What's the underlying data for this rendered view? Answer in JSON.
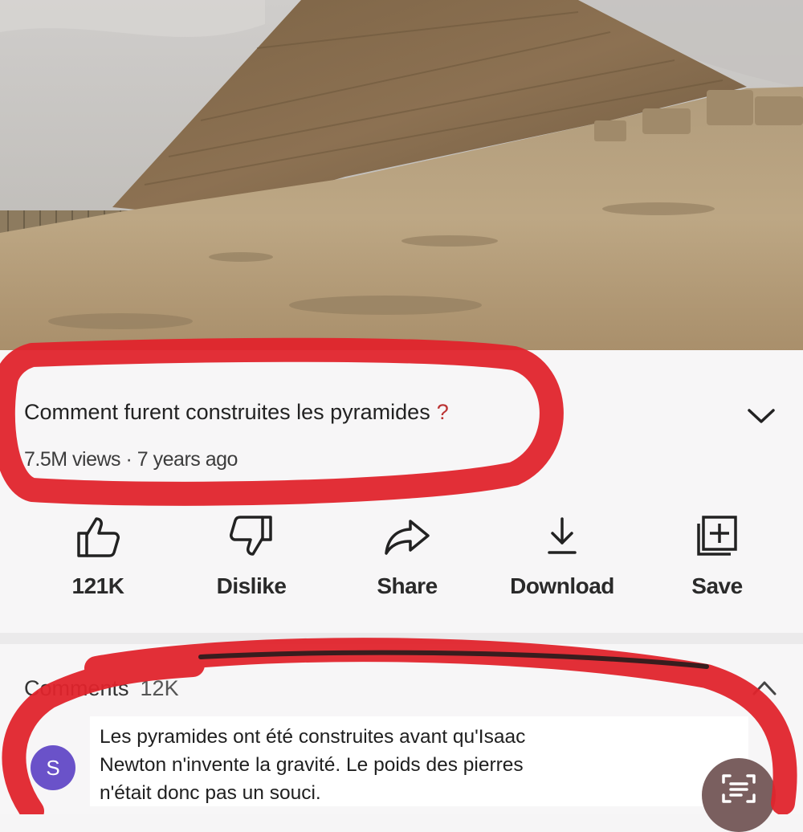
{
  "video": {
    "title": "Comment furent construites les pyramides",
    "title_punct": "?",
    "views": "7.5M views",
    "separator": "·",
    "age": "7 years ago"
  },
  "actions": [
    {
      "label": "121K",
      "icon": "thumbs-up-icon"
    },
    {
      "label": "Dislike",
      "icon": "thumbs-down-icon"
    },
    {
      "label": "Share",
      "icon": "share-icon"
    },
    {
      "label": "Download",
      "icon": "download-icon"
    },
    {
      "label": "Save",
      "icon": "save-to-playlist-icon"
    }
  ],
  "comments": {
    "header": "Comments",
    "count": "12K",
    "top_comment": {
      "avatar_letter": "S",
      "text": "Les pyramides ont été construites avant qu'Isaac\nNewton n'invente la gravité. Le poids des pierres\nn'était donc pas un souci."
    }
  },
  "colors": {
    "annotation_red": "#e0242c",
    "avatar": "#6a52c9",
    "lens_button": "#7a5f5f"
  }
}
